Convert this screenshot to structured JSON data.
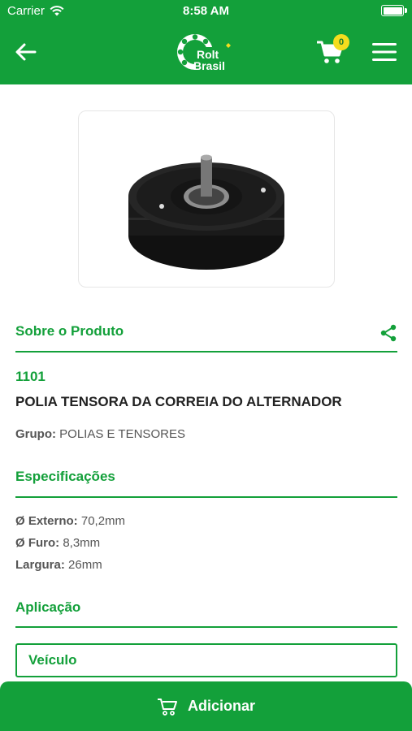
{
  "status": {
    "carrier": "Carrier",
    "time": "8:58 AM"
  },
  "header": {
    "logo_line1": "Rolt",
    "logo_line2": "Brasil",
    "cart_count": "0",
    "icons": {
      "back": "arrow-left-icon",
      "cart": "cart-icon",
      "menu": "hamburger-menu-icon"
    }
  },
  "product": {
    "image": "pulley-product-image",
    "about_title": "Sobre o Produto",
    "code": "1101",
    "name": "POLIA TENSORA DA CORREIA DO ALTERNADOR",
    "group_label": "Grupo:",
    "group_value": "POLIAS E TENSORES"
  },
  "specs": {
    "title": "Especificações",
    "items": [
      {
        "label": "Ø Externo:",
        "value": "70,2mm"
      },
      {
        "label": "Ø Furo:",
        "value": "8,3mm"
      },
      {
        "label": "Largura:",
        "value": "26mm"
      }
    ]
  },
  "application": {
    "title": "Aplicação",
    "column_header": "Veículo"
  },
  "footer": {
    "add_label": "Adicionar"
  },
  "colors": {
    "brand_green": "#13a03a",
    "badge_yellow": "#f5dd1e"
  }
}
